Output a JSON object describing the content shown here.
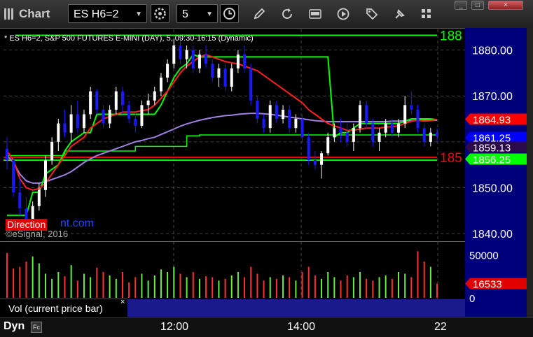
{
  "window": {
    "title": "Chart",
    "symbol_field": "ES H6=2",
    "interval_field": "5",
    "min_button": "_",
    "max_button": "□",
    "close_button": "×"
  },
  "toolbar_icons": [
    "gear-icon",
    "clock-icon",
    "pencil-icon",
    "refresh-icon",
    "get-icon",
    "play-icon",
    "tag-icon",
    "pin-icon",
    "grid-icon"
  ],
  "chart_subtitle": "* ES H6=2, S&P 500 FUTURES E-MINI (DAY), 5, 09:30-16:15 (Dynamic)",
  "watermark": {
    "red_text": "Direction",
    "blue_text": "nt.com"
  },
  "copyright": "©eSignal, 2016",
  "volume_panel": {
    "label": "Vol (current price bar)",
    "close": "×"
  },
  "bottom": {
    "dyn_label": "Dyn",
    "dyn_icon": "Fc"
  },
  "colors": {
    "up": "#ffffff",
    "down": "#1a1aff",
    "ema": "#ff2020",
    "vwap": "#a080e0",
    "trail": "#00ff00",
    "level_green": "#00ff00",
    "level_red": "#ff0000",
    "axis_bg": "#00007a"
  },
  "chart_data": {
    "type": "candlestick",
    "title": "",
    "xlabel": "",
    "ylabel": "",
    "x_ticks": [
      "12:00",
      "14:00",
      "22"
    ],
    "y_ticks": [
      "1840.00",
      "1850.00",
      "1860.00",
      "1870.00",
      "1880.00"
    ],
    "ylim": [
      1838.5,
      1884.5
    ],
    "level_labels": {
      "upper_green": "188",
      "lower_red": "185"
    },
    "price_labels": [
      {
        "text": "1864.93",
        "value": 1864.93,
        "color": "#ff0000"
      },
      {
        "text": "1861.25",
        "value": 1861.25,
        "color": "#0000ff"
      },
      {
        "text": "1859.13",
        "value": 1859.13,
        "color": "#2a0a4a"
      },
      {
        "text": "1856.25",
        "value": 1856.25,
        "color": "#00ff00"
      }
    ],
    "levels": [
      {
        "name": "upper-green",
        "value": 1883.2,
        "color": "#00ff00"
      },
      {
        "name": "lower-red",
        "value": 1856.6,
        "color": "#ff0000"
      },
      {
        "name": "lower-green",
        "value": 1856.0,
        "color": "#00ff00"
      }
    ],
    "candles": [
      [
        1858.5,
        1861,
        1854,
        1856
      ],
      [
        1856,
        1856.5,
        1848,
        1849
      ],
      [
        1849,
        1852,
        1844,
        1845.5
      ],
      [
        1845.5,
        1848,
        1840,
        1842
      ],
      [
        1842,
        1847,
        1841,
        1846
      ],
      [
        1846,
        1851,
        1845,
        1849.5
      ],
      [
        1849.5,
        1857,
        1848,
        1856
      ],
      [
        1856,
        1861,
        1855,
        1860
      ],
      [
        1860,
        1865,
        1858,
        1864
      ],
      [
        1864,
        1867,
        1861,
        1862
      ],
      [
        1862,
        1868,
        1860,
        1866
      ],
      [
        1866,
        1869,
        1862,
        1863
      ],
      [
        1863,
        1867,
        1862,
        1866
      ],
      [
        1866,
        1872,
        1865,
        1871
      ],
      [
        1871,
        1871.5,
        1866,
        1867
      ],
      [
        1867,
        1868,
        1863,
        1864
      ],
      [
        1864,
        1868,
        1863,
        1867
      ],
      [
        1867,
        1872,
        1866,
        1871
      ],
      [
        1871,
        1872,
        1866,
        1868
      ],
      [
        1868,
        1869,
        1864,
        1865
      ],
      [
        1865,
        1866,
        1862,
        1863.5
      ],
      [
        1863.5,
        1869,
        1863,
        1868
      ],
      [
        1868,
        1870.5,
        1866,
        1869
      ],
      [
        1869,
        1872,
        1868,
        1871
      ],
      [
        1871,
        1875,
        1870,
        1874
      ],
      [
        1874,
        1878,
        1873,
        1877
      ],
      [
        1877,
        1882.5,
        1876,
        1881
      ],
      [
        1881,
        1882,
        1877,
        1878
      ],
      [
        1878,
        1881,
        1876,
        1880
      ],
      [
        1880,
        1881,
        1875,
        1876
      ],
      [
        1876,
        1880,
        1875,
        1879
      ],
      [
        1879,
        1881,
        1876,
        1877
      ],
      [
        1877,
        1878,
        1873,
        1874
      ],
      [
        1874,
        1877,
        1872,
        1876
      ],
      [
        1876,
        1877,
        1871,
        1872
      ],
      [
        1872,
        1877,
        1871,
        1876
      ],
      [
        1876,
        1880,
        1875,
        1879
      ],
      [
        1879,
        1881,
        1875,
        1876
      ],
      [
        1876,
        1877,
        1868,
        1869
      ],
      [
        1869,
        1870,
        1864,
        1865
      ],
      [
        1865,
        1866,
        1862,
        1863
      ],
      [
        1863,
        1869,
        1862,
        1868
      ],
      [
        1868,
        1869,
        1864,
        1865
      ],
      [
        1865,
        1868,
        1864,
        1867
      ],
      [
        1867,
        1868,
        1862,
        1863
      ],
      [
        1863,
        1866,
        1862,
        1865
      ],
      [
        1865,
        1866,
        1860,
        1861
      ],
      [
        1861,
        1862,
        1855,
        1856
      ],
      [
        1856,
        1858,
        1854,
        1855
      ],
      [
        1855,
        1858,
        1852,
        1857.5
      ],
      [
        1857.5,
        1862,
        1857,
        1861
      ],
      [
        1861,
        1864,
        1860,
        1863
      ],
      [
        1863,
        1865,
        1860,
        1862
      ],
      [
        1862,
        1864,
        1859,
        1860
      ],
      [
        1860,
        1864,
        1858,
        1863
      ],
      [
        1863,
        1869,
        1862,
        1868
      ],
      [
        1868,
        1869,
        1863,
        1864
      ],
      [
        1864,
        1865,
        1859,
        1860
      ],
      [
        1860,
        1863,
        1858,
        1862
      ],
      [
        1862,
        1865,
        1861,
        1864
      ],
      [
        1864,
        1865,
        1861,
        1862
      ],
      [
        1862,
        1865,
        1861,
        1864
      ],
      [
        1864,
        1870,
        1863,
        1868
      ],
      [
        1868,
        1871,
        1866,
        1867
      ],
      [
        1867,
        1868,
        1862,
        1863
      ],
      [
        1863,
        1864,
        1859,
        1860
      ],
      [
        1860,
        1863,
        1859,
        1862
      ],
      [
        1862,
        1863,
        1860,
        1861.25
      ]
    ],
    "ema": [
      1858,
      1856,
      1852,
      1850,
      1849.5,
      1849.8,
      1851,
      1853,
      1855,
      1857,
      1859,
      1860,
      1861,
      1863,
      1864,
      1865,
      1865.5,
      1866,
      1866.5,
      1866.5,
      1866.5,
      1866.8,
      1867,
      1868,
      1869.5,
      1871,
      1873,
      1875,
      1876.5,
      1877.5,
      1878.5,
      1879,
      1878.5,
      1878,
      1877.5,
      1877.2,
      1877,
      1876.5,
      1876,
      1875.5,
      1874.5,
      1873.5,
      1872.5,
      1871.5,
      1870.5,
      1869.5,
      1868.5,
      1867,
      1866,
      1865,
      1864,
      1863.5,
      1863,
      1862.5,
      1862.5,
      1862.8,
      1863,
      1863,
      1863,
      1863.2,
      1863.3,
      1863.5,
      1864,
      1864.5,
      1864.7,
      1864.5,
      1864.6,
      1864.93
    ],
    "vwap": [
      1857,
      1855.5,
      1853,
      1851.5,
      1851,
      1851,
      1851.3,
      1851.8,
      1852.3,
      1852.8,
      1853.5,
      1854.5,
      1855.5,
      1856.3,
      1857,
      1857.5,
      1858,
      1858.5,
      1859,
      1859.5,
      1860,
      1860.3,
      1860.7,
      1861,
      1861.6,
      1862.2,
      1862.8,
      1863.4,
      1863.9,
      1864.3,
      1864.7,
      1865,
      1865.3,
      1865.5,
      1865.7,
      1865.8,
      1866,
      1866.1,
      1866.2,
      1866.2,
      1866.1,
      1866,
      1865.8,
      1865.6,
      1865.4,
      1865.2,
      1865,
      1864.8,
      1864.6,
      1864.5,
      1864.4,
      1864.4,
      1864.4,
      1864.4,
      1864.4,
      1864.4,
      1864.4,
      1864.4,
      1864.4,
      1864.4,
      1864.5,
      1864.5,
      1864.6,
      1864.6,
      1864.7,
      1864.7,
      1864.7,
      1864.7
    ],
    "trail": [
      1844,
      1844,
      1844,
      1844,
      1849,
      1849,
      1853,
      1854,
      1855,
      1858,
      1860,
      1861,
      1862,
      1862,
      1866,
      1866,
      1866,
      1866,
      1866,
      1866,
      1866,
      1866,
      1866,
      1866,
      1868,
      1871,
      1874,
      1876,
      1877,
      1879,
      1878.5,
      1878.5,
      1878.5,
      1878.5,
      1878.5,
      1878.5,
      1878.5,
      1878.5,
      1878.5,
      1878.5,
      1878.5,
      1878.5,
      1878.5,
      1878.5,
      1878.5,
      1878.5,
      1878.5,
      1878.5,
      1878.5,
      1878.5,
      1878.5,
      1861,
      1862,
      1862,
      1863,
      1864,
      1864,
      1864,
      1864,
      1864,
      1864,
      1864,
      1864.5,
      1865,
      1865,
      1865,
      1865,
      1864.8
    ],
    "vwap_step": [
      1857,
      1857,
      1857,
      1857,
      1857,
      1857,
      1857,
      1857,
      1857,
      1858,
      1858,
      1858,
      1858,
      1858,
      1858,
      1858,
      1858,
      1858,
      1858,
      1858,
      1859,
      1859,
      1859,
      1859,
      1859,
      1859,
      1859,
      1859,
      1861.3,
      1861.3,
      1861.5,
      1861.5,
      1861.5,
      1861.5,
      1861.5,
      1861.5,
      1861.5,
      1861.5,
      1861.5,
      1861.5,
      1861.5,
      1861.5,
      1861.5,
      1861.5,
      1861.5,
      1861.5,
      1861.5,
      1861.5,
      1861.5,
      1861.5,
      1861.5,
      1861.5,
      1861.5,
      1861.5,
      1861.5,
      1861.5,
      1861.5,
      1861.5,
      1861.5,
      1861.5,
      1861.5,
      1861.5,
      1861.5,
      1861.5,
      1861.5,
      1861.5,
      1861.5,
      1861.5
    ],
    "volume": {
      "y_ticks": [
        "50000",
        "0"
      ],
      "ylim": [
        0,
        60000
      ],
      "current_label": "16533",
      "values": [
        52000,
        34000,
        36000,
        42000,
        48000,
        40000,
        28000,
        22000,
        30000,
        25000,
        38000,
        20000,
        28000,
        24000,
        35000,
        30000,
        26000,
        22000,
        30000,
        18000,
        24000,
        28000,
        20000,
        26000,
        33000,
        30000,
        36000,
        28000,
        24000,
        30000,
        22000,
        25000,
        24000,
        20000,
        22000,
        26000,
        30000,
        24000,
        36000,
        28000,
        20000,
        24000,
        22000,
        26000,
        24000,
        20000,
        30000,
        36000,
        26000,
        22000,
        30000,
        24000,
        20000,
        26000,
        24000,
        30000,
        22000,
        20000,
        24000,
        26000,
        22000,
        30000,
        28000,
        24000,
        54000,
        42000,
        36000,
        16533
      ]
    }
  }
}
